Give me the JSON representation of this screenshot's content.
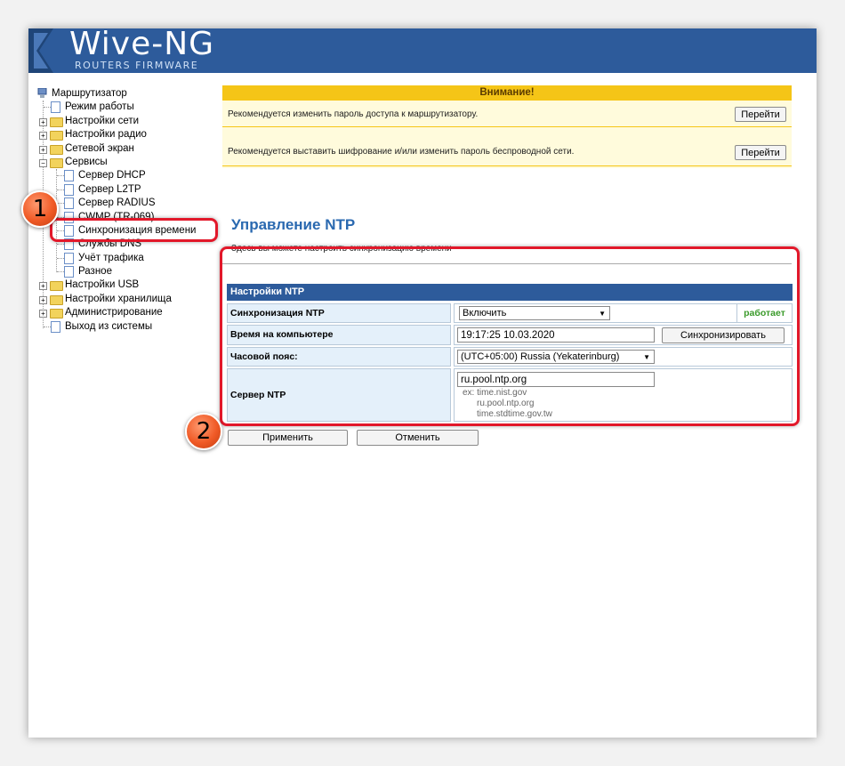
{
  "header": {
    "logo_title": "Wive-NG",
    "logo_subtitle": "ROUTERS FIRMWARE",
    "bg_color": "#2d5b9b"
  },
  "sidebar": {
    "items": [
      {
        "label": "Маршрутизатор",
        "type": "root",
        "level": 0
      },
      {
        "label": "Режим работы",
        "type": "page",
        "level": 1
      },
      {
        "label": "Настройки сети",
        "type": "folder",
        "level": 1
      },
      {
        "label": "Настройки радио",
        "type": "folder",
        "level": 1
      },
      {
        "label": "Сетевой экран",
        "type": "folder",
        "level": 1
      },
      {
        "label": "Сервисы",
        "type": "folder-open",
        "level": 1
      },
      {
        "label": "Сервер DHCP",
        "type": "page",
        "level": 2
      },
      {
        "label": "Сервер L2TP",
        "type": "page",
        "level": 2
      },
      {
        "label": "Сервер RADIUS",
        "type": "page",
        "level": 2
      },
      {
        "label": "CWMP (TR-069)",
        "type": "page",
        "level": 2
      },
      {
        "label": "Синхронизация времени",
        "type": "page",
        "level": 2,
        "selected": true
      },
      {
        "label": "Службы DNS",
        "type": "page",
        "level": 2
      },
      {
        "label": "Учёт трафика",
        "type": "page",
        "level": 2
      },
      {
        "label": "Разное",
        "type": "page",
        "level": 2
      },
      {
        "label": "Настройки USB",
        "type": "folder",
        "level": 1
      },
      {
        "label": "Настройки хранилища",
        "type": "folder",
        "level": 1
      },
      {
        "label": "Администрирование",
        "type": "folder",
        "level": 1
      },
      {
        "label": "Выход из системы",
        "type": "page",
        "level": 1
      }
    ]
  },
  "warning": {
    "title": "Внимание!",
    "messages": [
      {
        "text": "Рекомендуется изменить пароль доступа к маршрутизатору.",
        "button": "Перейти"
      },
      {
        "text": "Рекомендуется выставить шифрование и/или изменить пароль беспроводной сети.",
        "button": "Перейти"
      }
    ]
  },
  "page": {
    "title": "Управление NTP",
    "description": "Здесь вы можете настроить синхронизацию времени"
  },
  "ntp": {
    "table_title": "Настройки NTP",
    "sync_label": "Синхронизация NTP",
    "sync_value": "Включить",
    "sync_status": "работает",
    "time_label": "Время на компьютере",
    "time_value": "19:17:25 10.03.2020",
    "sync_button": "Синхронизировать",
    "tz_label": "Часовой пояс:",
    "tz_value": "(UTC+05:00) Russia (Yekaterinburg)",
    "server_label": "Сервер NTP",
    "server_value": "ru.pool.ntp.org",
    "hint_1": "ex: time.nist.gov",
    "hint_2": "ru.pool.ntp.org",
    "hint_3": "time.stdtime.gov.tw",
    "apply_button": "Применить",
    "cancel_button": "Отменить"
  },
  "annotations": {
    "step_1": "1",
    "step_2": "2"
  },
  "colors": {
    "accent": "#2a69b0",
    "warning": "#f5c517",
    "status_ok": "#3a9a2a",
    "annotation": "#e2182a"
  }
}
